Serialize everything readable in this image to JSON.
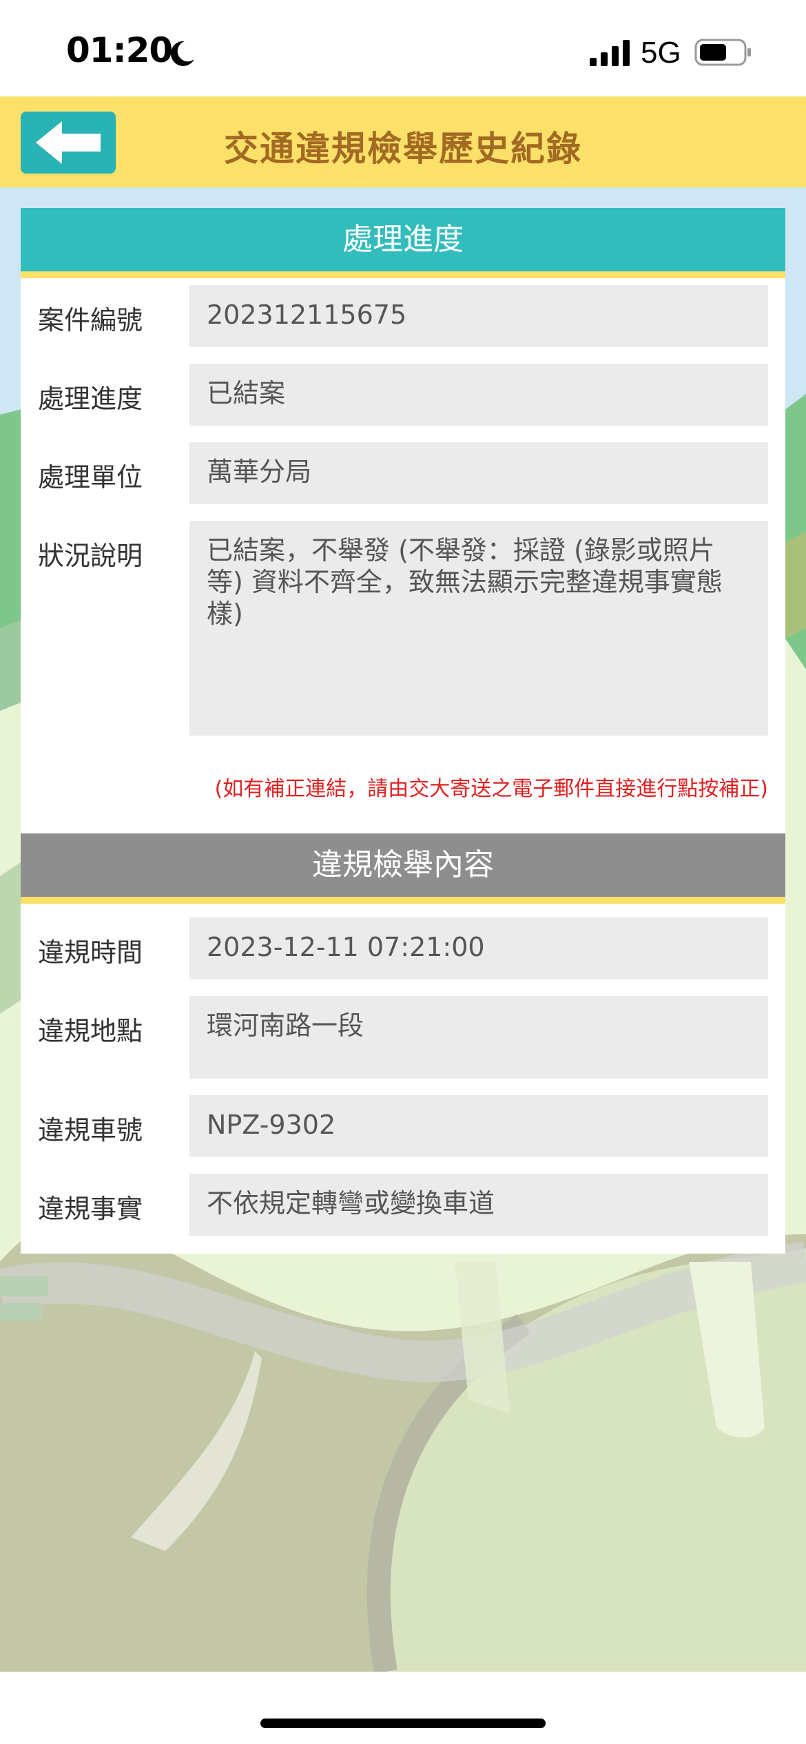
{
  "status_bar": {
    "time": "01:20",
    "network": "5G",
    "icons": [
      "moon-icon",
      "signal-icon",
      "battery-icon"
    ]
  },
  "header": {
    "title": "交通違規檢舉歷史紀錄",
    "back_icon": "arrow-left-icon",
    "background_color": "#fbe06a",
    "title_color": "#a26a22",
    "button_color": "#2ab3b5"
  },
  "progress_section": {
    "title": "處理進度",
    "header_color": "#33bcbc",
    "rows": [
      {
        "label": "案件編號",
        "value": "202312115675"
      },
      {
        "label": "處理進度",
        "value": "已結案"
      },
      {
        "label": "處理單位",
        "value": "萬華分局"
      },
      {
        "label": "狀況說明",
        "value": "已結案，不舉發 (不舉發：採證 (錄影或照片等) 資料不齊全，致無法顯示完整違規事實態樣)"
      }
    ],
    "notice": "(如有補正連結，請由交大寄送之電子郵件直接進行點按補正)",
    "notice_color": "#e02020"
  },
  "report_section": {
    "title": "違規檢舉內容",
    "header_color": "#8e8e8e",
    "rows": [
      {
        "label": "違規時間",
        "value": "2023-12-11 07:21:00"
      },
      {
        "label": "違規地點",
        "value": "環河南路一段"
      },
      {
        "label": "違規車號",
        "value": "NPZ-9302"
      },
      {
        "label": "違規事實",
        "value": "不依規定轉彎或變換車道"
      }
    ]
  }
}
